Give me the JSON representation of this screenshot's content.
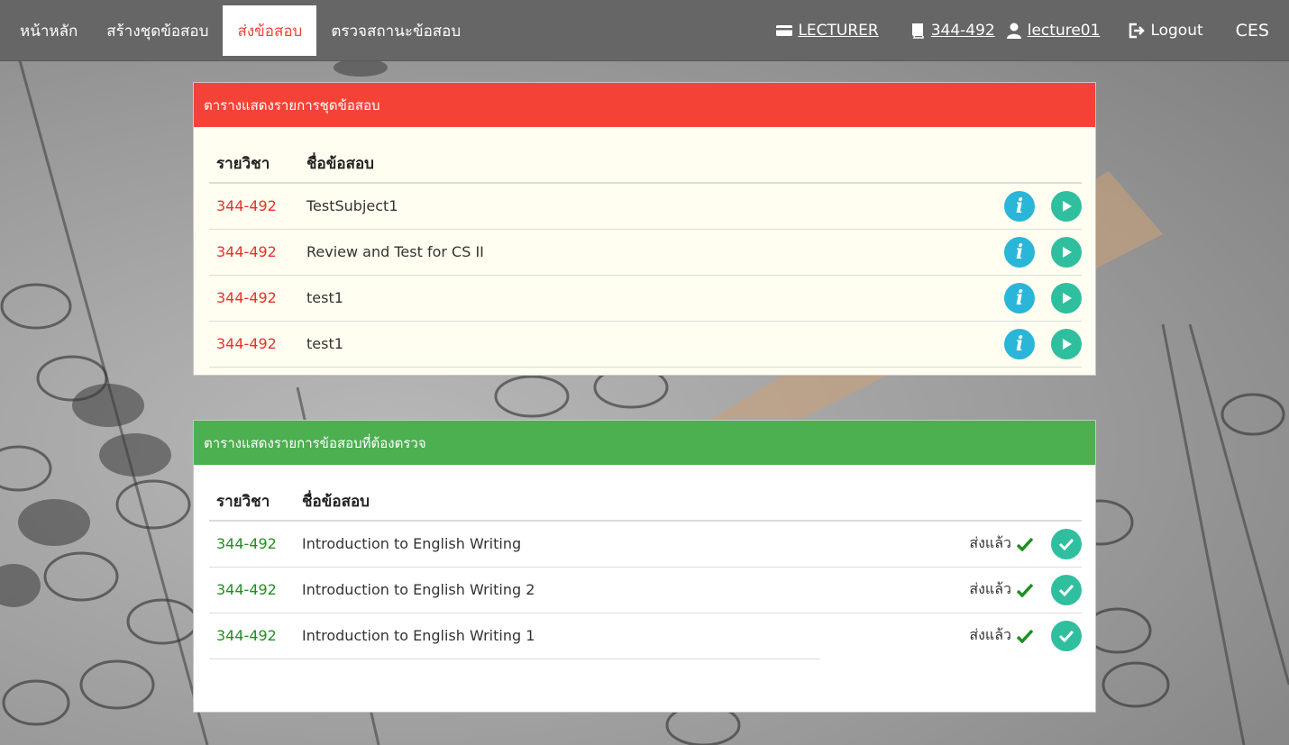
{
  "nav": {
    "items": [
      {
        "label": "หน้าหลัก",
        "active": false
      },
      {
        "label": "สร้างชุดข้อสอบ",
        "active": false
      },
      {
        "label": "ส่งข้อสอบ",
        "active": true
      },
      {
        "label": "ตรวจสถานะข้อสอบ",
        "active": false
      }
    ],
    "role": "LECTURER",
    "course": "344-492",
    "user": "lecture01",
    "logout": "Logout",
    "brand": "CES"
  },
  "exam_sets": {
    "title": "ตารางแสดงรายการชุดข้อสอบ",
    "header_color": "#f44336",
    "columns": [
      "รายวิชา",
      "ชื่อข้อสอบ"
    ],
    "rows": [
      {
        "code": "344-492",
        "name": "TestSubject1"
      },
      {
        "code": "344-492",
        "name": "Review and Test for CS II"
      },
      {
        "code": "344-492",
        "name": "test1"
      },
      {
        "code": "344-492",
        "name": "test1"
      }
    ],
    "actions": [
      "info-icon",
      "play-icon"
    ]
  },
  "to_grade": {
    "title": "ตารางแสดงรายการข้อสอบที่ต้องตรวจ",
    "header_color": "#4caf50",
    "columns": [
      "รายวิชา",
      "ชื่อข้อสอบ"
    ],
    "rows": [
      {
        "code": "344-492",
        "name": "Introduction to English Writing",
        "status": "ส่งแล้ว"
      },
      {
        "code": "344-492",
        "name": "Introduction to English Writing 2",
        "status": "ส่งแล้ว"
      },
      {
        "code": "344-492",
        "name": "Introduction to English Writing 1",
        "status": "ส่งแล้ว"
      }
    ],
    "actions": [
      "check-icon"
    ]
  }
}
